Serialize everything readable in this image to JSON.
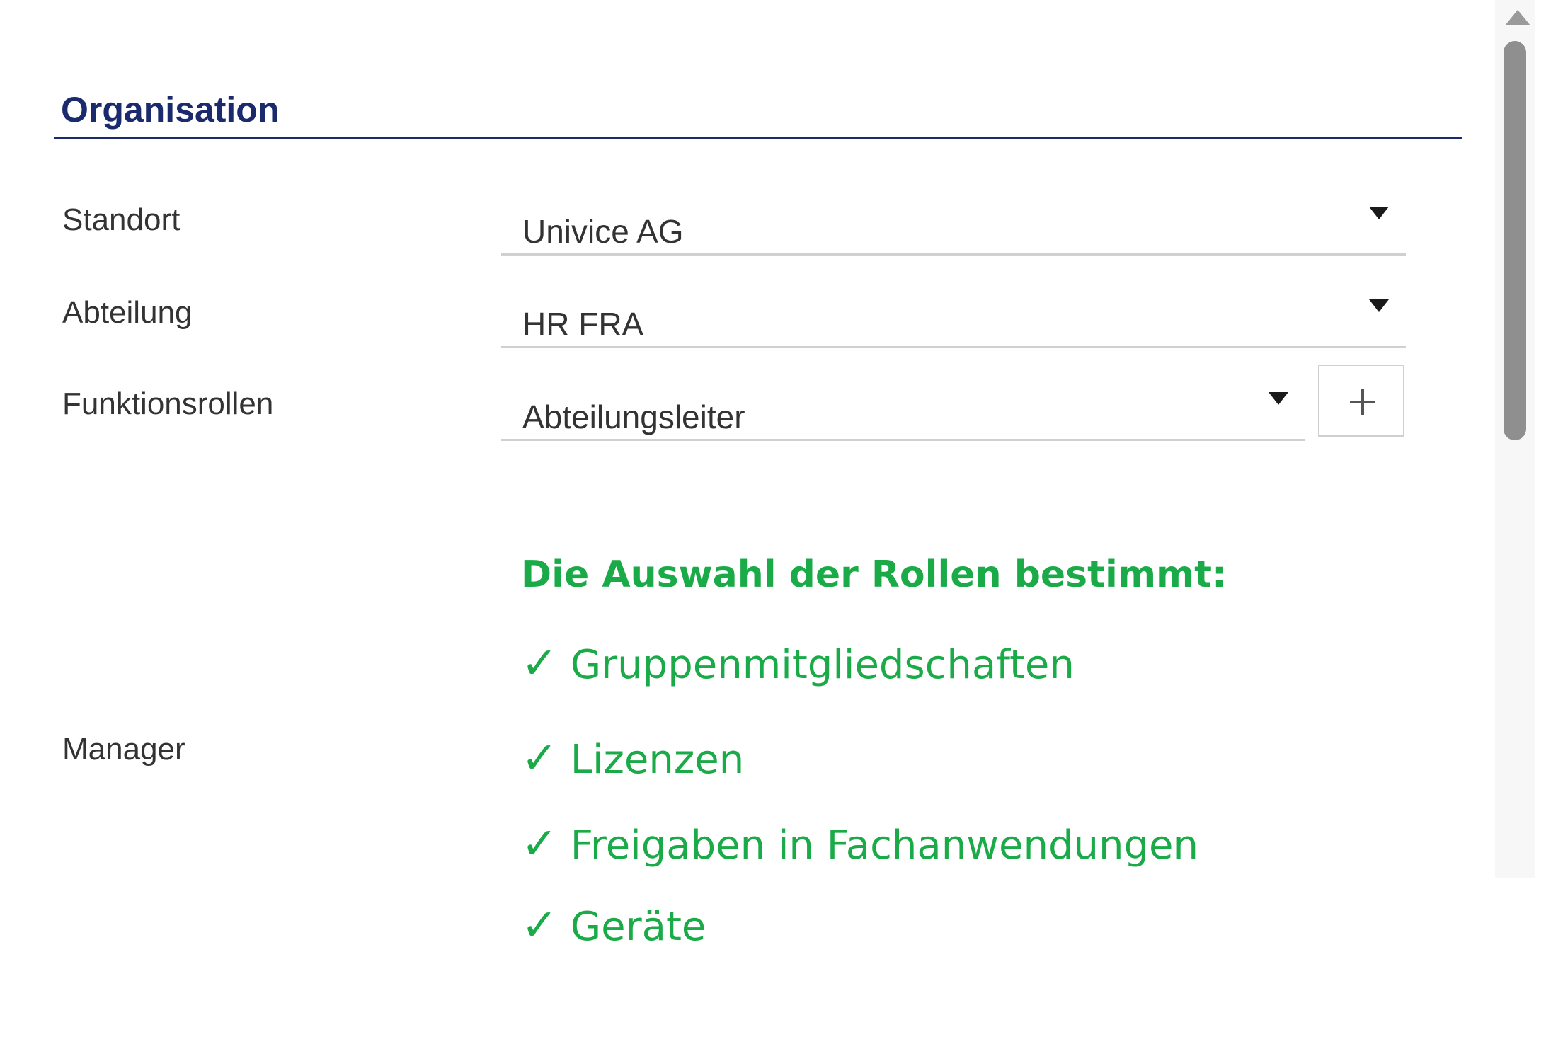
{
  "section": {
    "title": "Organisation"
  },
  "fields": {
    "standort": {
      "label": "Standort",
      "value": "Univice AG"
    },
    "abteilung": {
      "label": "Abteilung",
      "value": "HR FRA"
    },
    "funktionsrollen": {
      "label": "Funktionsrollen",
      "value": "Abteilungsleiter",
      "add_symbol": "+"
    },
    "manager": {
      "label": "Manager"
    }
  },
  "note": {
    "title": "Die Auswahl der Rollen bestimmt:",
    "check_glyph": "✓",
    "items": [
      "Gruppenmitgliedschaften",
      "Lizenzen",
      "Freigaben in Fachanwendungen",
      "Geräte"
    ]
  },
  "colors": {
    "heading": "#1a2a6c",
    "note_green": "#1aab48",
    "field_border": "#d0d0d0",
    "scrollbar_thumb": "#8f8f8f"
  },
  "icons": {
    "dropdown": "caret-down-icon",
    "add": "plus-icon",
    "scroll_up": "arrow-up-icon",
    "check": "checkmark-icon"
  }
}
